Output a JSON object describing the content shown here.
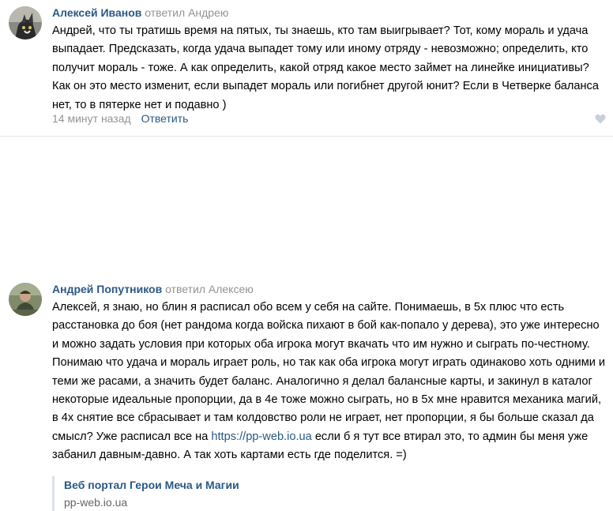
{
  "comments": [
    {
      "author": "Алексей Иванов",
      "reply_to": "ответил Андрею",
      "text": "Андрей, что ты тратишь время на пятых, ты знаешь, кто там выигрывает? Тот, кому мораль и удача выпадает. Предсказать, когда удача выпадет тому или иному отряду - невозможно; определить, кто получит мораль - тоже. А как определить, какой отряд какое место займет на линейке инициативы? Как он это место изменит, если выпадет мораль или погибнет другой юнит? Если в Четверке баланса нет, то в пятерке нет и подавно )",
      "time": "14 минут назад",
      "reply_label": "Ответить",
      "like_icon": "heart-icon"
    },
    {
      "author": "Андрей Попутников",
      "reply_to": "ответил Алексею",
      "text_before_link": "Алексей, я знаю, но блин я расписал обо всем у себя на сайте. Понимаешь, в 5х плюс что есть расстановка до боя (нет рандома когда войска пихают в бой как-попало у дерева), это уже интересно и можно задать условия при которых оба игрока могут вкачать что им нужно и сыграть по-честному. Понимаю что удача и мораль играет роль, но так как оба игрока могут играть одинаково хоть одними и теми же расами, а значить будет баланс. Аналогично я делал балансные карты, и закинул в каталог некоторые идеальные пропорции, да в 4е тоже можно сыграть, но в 5х мне нравится механика магий, в 4х снятие все сбрасывает и там колдовство роли не играет, нет пропорции, я бы больше сказал да смысл? Уже расписал все на ",
      "link_text": "https://pp-web.io.ua",
      "text_after_link": " если б я тут все втирал это, то админ бы меня уже забанил давным-давно. А так хоть картами есть где поделится. =)",
      "snippet": {
        "title": "Веб портал Герои Меча и Магии",
        "domain": "pp-web.io.ua"
      }
    }
  ],
  "colors": {
    "link": "#2a5885",
    "muted": "#939393",
    "divider": "#e7e8ec",
    "snippet_bar": "#dae2ea"
  }
}
